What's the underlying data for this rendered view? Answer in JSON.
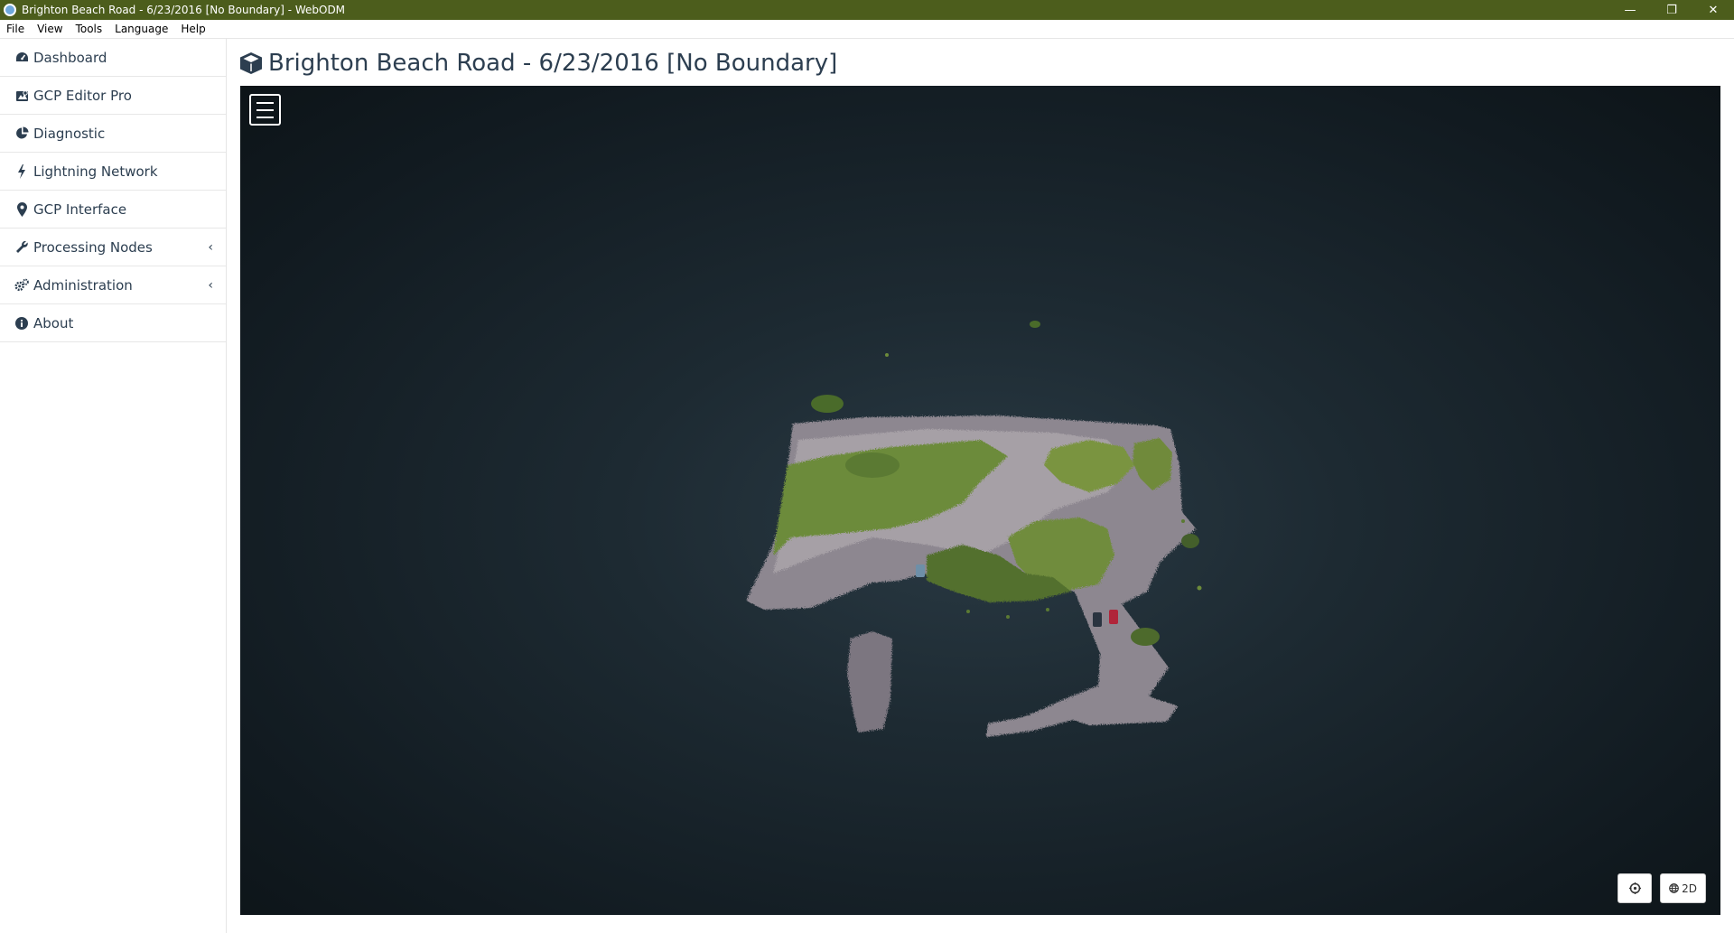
{
  "window": {
    "title": "Brighton Beach Road - 6/23/2016 [No Boundary] - WebODM",
    "controls": [
      "—",
      "❐",
      "✕"
    ]
  },
  "menubar": {
    "items": [
      "File",
      "View",
      "Tools",
      "Language",
      "Help"
    ]
  },
  "sidebar": {
    "items": [
      {
        "label": "Dashboard",
        "icon": "dashboard-icon"
      },
      {
        "label": "GCP Editor Pro",
        "icon": "map-icon"
      },
      {
        "label": "Diagnostic",
        "icon": "pie-chart-icon"
      },
      {
        "label": "Lightning Network",
        "icon": "bolt-icon"
      },
      {
        "label": "GCP Interface",
        "icon": "map-marker-icon"
      },
      {
        "label": "Processing Nodes",
        "icon": "wrench-icon",
        "chevron": "‹"
      },
      {
        "label": "Administration",
        "icon": "gears-icon",
        "chevron": "‹"
      },
      {
        "label": "About",
        "icon": "info-icon"
      }
    ]
  },
  "main": {
    "title": "Brighton Beach Road - 6/23/2016 [No Boundary]",
    "viewer": {
      "buttons": {
        "target_icon": "crosshair-icon",
        "mode_label": "2D"
      }
    }
  },
  "colors": {
    "titlebar": "#4c5d1c",
    "text": "#2c3e50",
    "viewer_bg": "#1d2a32"
  }
}
